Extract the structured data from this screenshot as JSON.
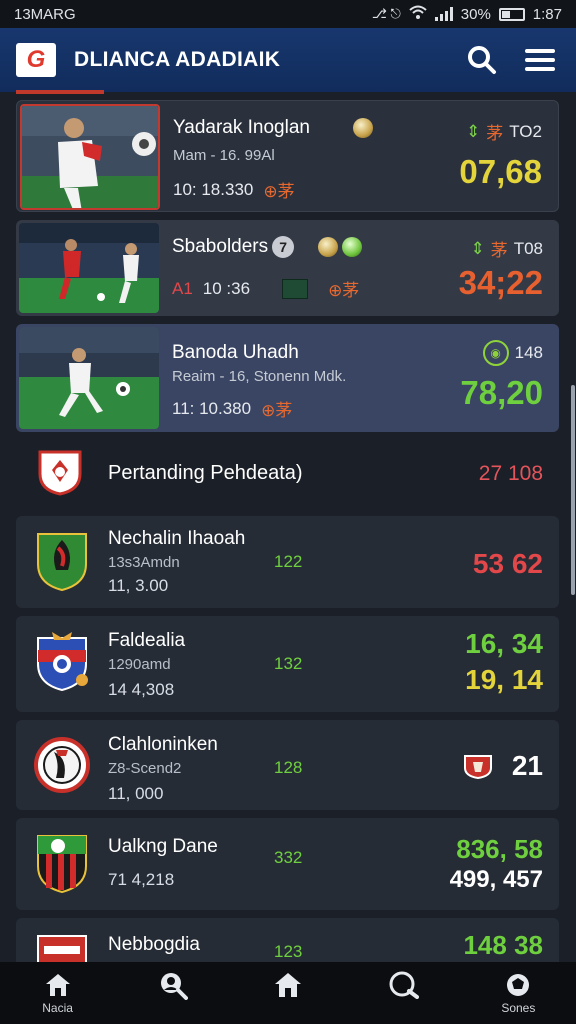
{
  "status_bar": {
    "time_left": "13MARG",
    "icons_text": "∮ ∮",
    "battery": "30%",
    "time_right": "1:87"
  },
  "header": {
    "logo_text": "G",
    "title": "DLIANCA ADADIAIK"
  },
  "featured": [
    {
      "title": "Yadarak Inoglan",
      "subtitle": "Mam  -  16. 99Al",
      "meta": "10: 18.330",
      "right_top": "TO2",
      "score": "07,68",
      "score_color": "#e2d43a"
    },
    {
      "title": "Sbabolders",
      "badge": "7",
      "meta_prefix": "A1",
      "meta": "10 :36",
      "right_top": "T08",
      "score": "34;22",
      "score_color": "#e7602f"
    },
    {
      "title": "Banoda Uhadh",
      "subtitle": "Reaim - 16, Stonenn Mdk.",
      "meta": "11: 10.380",
      "right_top": "148",
      "score": "78,20",
      "score_color": "#6fd03f"
    }
  ],
  "section": {
    "title": "Pertanding Pehdeata)",
    "value": "27  108"
  },
  "list": [
    {
      "name": "Nechalin Ihaoah",
      "sub": "13s3Amdn",
      "value": "11, 3.00",
      "mid": "122",
      "score_lines": [
        "53  62"
      ],
      "score_colors": [
        "#e2474a"
      ]
    },
    {
      "name": "Faldealia",
      "sub": "1290amd",
      "value": "14  4,308",
      "mid": "132",
      "score_lines": [
        "16, 34",
        "19, 14"
      ],
      "score_colors": [
        "#6fd03f",
        "#e2d43a"
      ]
    },
    {
      "name": "Clahloninken",
      "sub": "Z8-Scend2",
      "value": "11, 000",
      "mid": "128",
      "score_lines": [
        "21"
      ],
      "score_colors": [
        "#ffffff"
      ]
    },
    {
      "name": "Ualkng Dane",
      "sub": "",
      "value": "71  4,218",
      "mid": "332",
      "score_lines": [
        "836, 58",
        "499, 457"
      ],
      "score_colors": [
        "#6fd03f",
        "#ffffff"
      ]
    },
    {
      "name": "Nebbogdia",
      "sub": "",
      "value": "",
      "mid": "123",
      "score_lines": [
        "148  38"
      ],
      "score_colors": [
        "#6fd03f"
      ]
    }
  ],
  "nav": [
    {
      "label": "Nacia",
      "icon": "home-icon"
    },
    {
      "label": "",
      "icon": "search-person-icon"
    },
    {
      "label": "",
      "icon": "home-icon"
    },
    {
      "label": "",
      "icon": "chat-icon"
    },
    {
      "label": "Sones",
      "icon": "ball-icon"
    }
  ],
  "colors": {
    "app_bar": "#18376e",
    "background": "#1b1f27",
    "accent_red": "#c0392b"
  }
}
